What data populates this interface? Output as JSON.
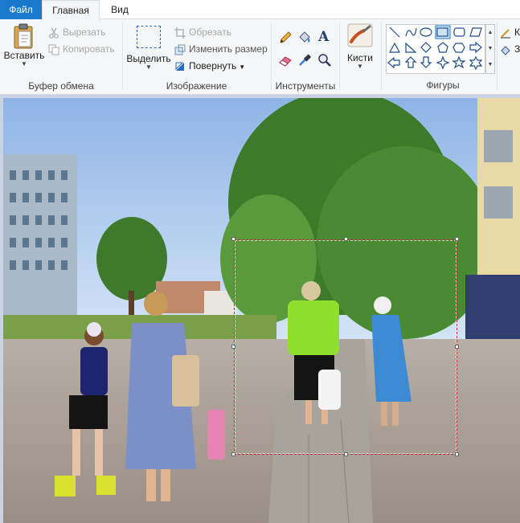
{
  "tabs": [
    {
      "label": "Файл"
    },
    {
      "label": "Главная"
    },
    {
      "label": "Вид"
    }
  ],
  "clipboard": {
    "paste_label": "Вставить",
    "cut_label": "Вырезать",
    "copy_label": "Копировать",
    "group_label": "Буфер обмена"
  },
  "image": {
    "select_label": "Выделить",
    "crop_label": "Обрезать",
    "resize_label": "Изменить размер",
    "rotate_label": "Повернуть",
    "group_label": "Изображение"
  },
  "tools": {
    "group_label": "Инструменты",
    "items": [
      "pencil-icon",
      "fill-bucket-icon",
      "text-icon",
      "eraser-icon",
      "color-picker-icon",
      "magnifier-icon"
    ]
  },
  "brushes": {
    "label": "Кисти"
  },
  "shapes": {
    "group_label": "Фигуры",
    "selected": "rectangle",
    "items": [
      "line",
      "curve",
      "oval",
      "rectangle",
      "rounded-rectangle",
      "polygon",
      "triangle",
      "right-triangle",
      "diamond",
      "pentagon",
      "hexagon",
      "right-arrow",
      "left-arrow",
      "up-arrow",
      "down-arrow",
      "four-point-star",
      "five-point-star",
      "six-point-star"
    ]
  },
  "partial_right": {
    "outline_label": "К",
    "fill_label": "З"
  },
  "colors": {
    "file_tab": "#1979ca",
    "selection_border": "#c0283a",
    "ribbon_bg": "#f5f6f7",
    "workspace_bg": "#c9d3e2"
  }
}
